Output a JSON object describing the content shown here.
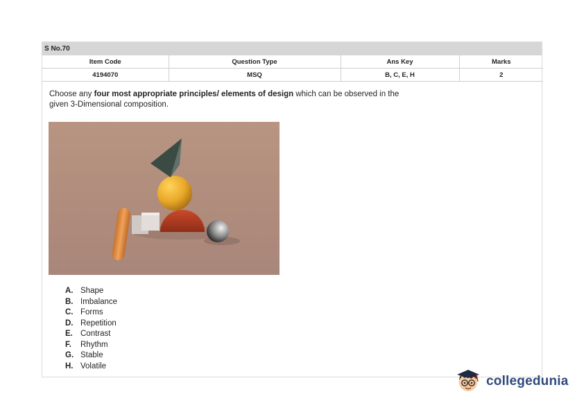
{
  "sno": "S No.70",
  "headers": [
    "Item Code",
    "Question Type",
    "Ans Key",
    "Marks"
  ],
  "values": [
    "4194070",
    "MSQ",
    "B, C, E, H",
    "2"
  ],
  "question": {
    "prefix": "Choose any ",
    "bold": "four most appropriate principles/ elements of design",
    "suffix": " which can be observed in the given 3-Dimensional composition."
  },
  "options": [
    {
      "letter": "A.",
      "text": "Shape"
    },
    {
      "letter": "B.",
      "text": "Imbalance"
    },
    {
      "letter": "C.",
      "text": "Forms"
    },
    {
      "letter": "D.",
      "text": "Repetition"
    },
    {
      "letter": "E.",
      "text": "Contrast"
    },
    {
      "letter": "F.",
      "text": "Rhythm"
    },
    {
      "letter": "G.",
      "text": "Stable"
    },
    {
      "letter": "H.",
      "text": "Volatile"
    }
  ],
  "brand": {
    "name": "collegedunia"
  }
}
